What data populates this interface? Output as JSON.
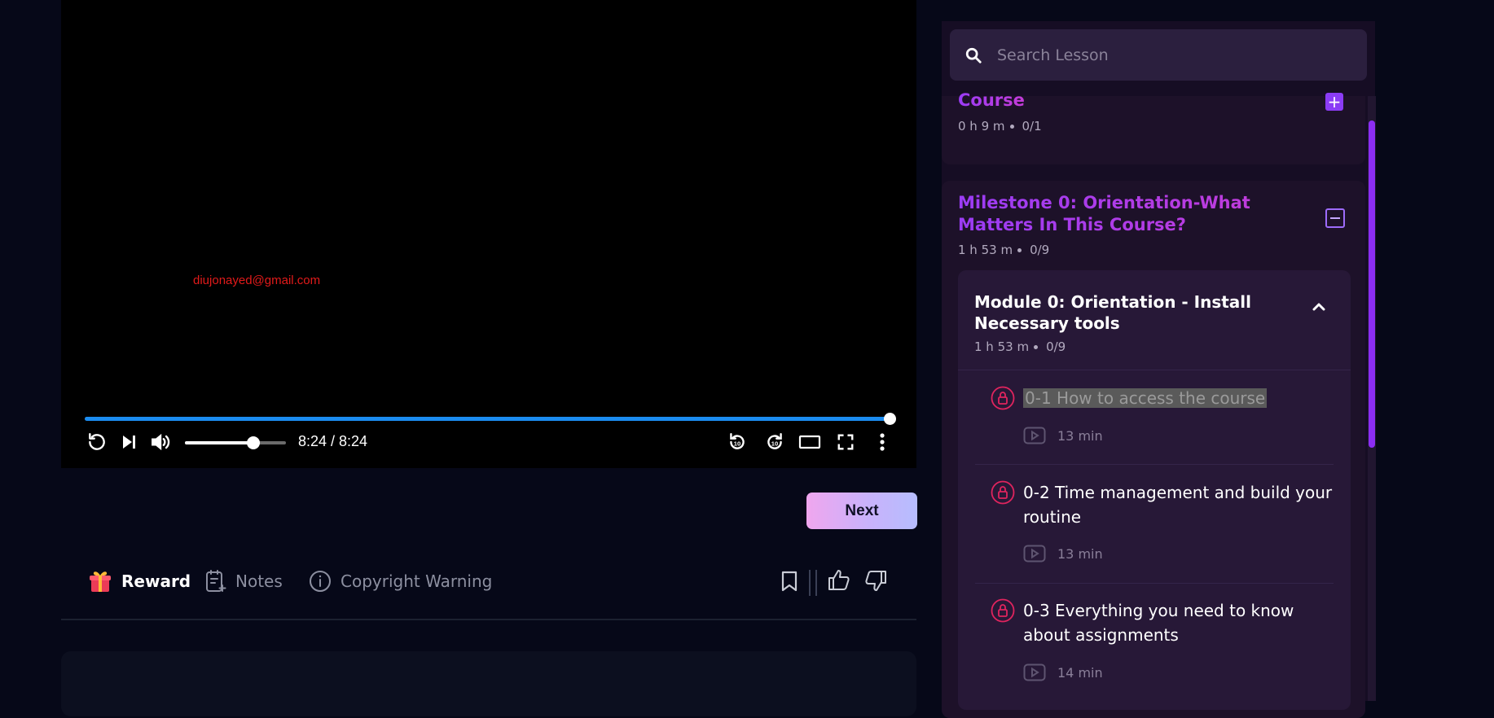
{
  "video": {
    "watermark": "diujonayed@gmail.com",
    "time_display": "8:24 / 8:24",
    "progress": 1.0,
    "volume": 0.68,
    "colors": {
      "progress": "#1b8cf0",
      "watermark": "#e21a1a"
    }
  },
  "actions": {
    "next_label": "Next"
  },
  "tabs": [
    {
      "label": "Reward",
      "icon": "gift-icon",
      "active": true
    },
    {
      "label": "Notes",
      "icon": "notes-icon"
    },
    {
      "label": "Copyright Warning",
      "icon": "info-icon"
    }
  ],
  "sidebar": {
    "search_placeholder": "Search Lesson",
    "course_section": {
      "title": "Course",
      "duration": "0 h 9 m",
      "progress": "0/1"
    },
    "milestone": {
      "title": "Milestone 0: Orientation-What Matters In This Course?",
      "duration": "1 h 53 m",
      "progress": "0/9",
      "module": {
        "title": "Module 0: Orientation - Install Necessary tools",
        "duration": "1 h 53 m",
        "progress": "0/9",
        "lessons": [
          {
            "title": "0-1 How to access the course",
            "duration": "13 min"
          },
          {
            "title": "0-2 Time management and build your routine",
            "duration": "13 min"
          },
          {
            "title": "0-3 Everything you need to know about assignments",
            "duration": "14 min"
          }
        ]
      }
    }
  },
  "colors": {
    "accent_purple": "#8b3cf5",
    "lock_red": "#e0245e",
    "next_gradient_start": "#f0a6ee",
    "next_gradient_end": "#b6bdfe"
  }
}
